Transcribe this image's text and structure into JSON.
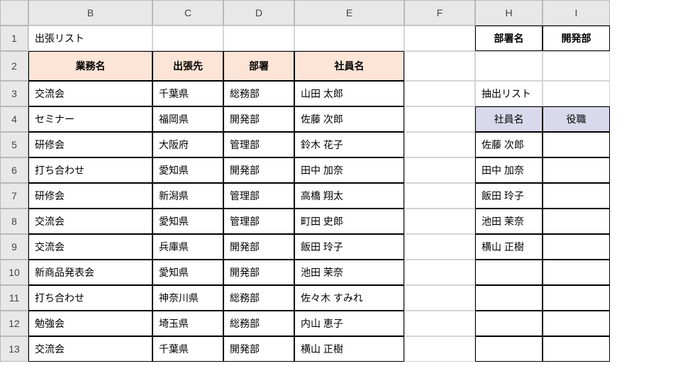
{
  "columns": [
    "",
    "B",
    "C",
    "D",
    "E",
    "F",
    "H",
    "I"
  ],
  "rows": [
    "1",
    "2",
    "3",
    "4",
    "5",
    "6",
    "7",
    "8",
    "9",
    "10",
    "11",
    "12",
    "13"
  ],
  "b1": "出張リスト",
  "main_headers": {
    "b": "業務名",
    "c": "出張先",
    "d": "部署",
    "e": "社員名"
  },
  "main_data": [
    {
      "b": "交流会",
      "c": "千葉県",
      "d": "総務部",
      "e": "山田 太郎"
    },
    {
      "b": "セミナー",
      "c": "福岡県",
      "d": "開発部",
      "e": "佐藤 次郎"
    },
    {
      "b": "研修会",
      "c": "大阪府",
      "d": "管理部",
      "e": "鈴木 花子"
    },
    {
      "b": "打ち合わせ",
      "c": "愛知県",
      "d": "開発部",
      "e": "田中 加奈"
    },
    {
      "b": "研修会",
      "c": "新潟県",
      "d": "管理部",
      "e": "高橋 翔太"
    },
    {
      "b": "交流会",
      "c": "愛知県",
      "d": "管理部",
      "e": "町田 史郎"
    },
    {
      "b": "交流会",
      "c": "兵庫県",
      "d": "開発部",
      "e": "飯田 玲子"
    },
    {
      "b": "新商品発表会",
      "c": "愛知県",
      "d": "開発部",
      "e": "池田 茉奈"
    },
    {
      "b": "打ち合わせ",
      "c": "神奈川県",
      "d": "総務部",
      "e": "佐々木 すみれ"
    },
    {
      "b": "勉強会",
      "c": "埼玉県",
      "d": "総務部",
      "e": "内山 恵子"
    },
    {
      "b": "交流会",
      "c": "千葉県",
      "d": "開発部",
      "e": "横山 正樹"
    }
  ],
  "filter": {
    "label": "部署名",
    "value": "開発部"
  },
  "extract_title": "抽出リスト",
  "extract_headers": {
    "h": "社員名",
    "i": "役職"
  },
  "extract_data": [
    {
      "h": "佐藤 次郎",
      "i": ""
    },
    {
      "h": "田中 加奈",
      "i": ""
    },
    {
      "h": "飯田 玲子",
      "i": ""
    },
    {
      "h": "池田 茉奈",
      "i": ""
    },
    {
      "h": "横山 正樹",
      "i": ""
    },
    {
      "h": "",
      "i": ""
    },
    {
      "h": "",
      "i": ""
    },
    {
      "h": "",
      "i": ""
    },
    {
      "h": "",
      "i": ""
    }
  ]
}
